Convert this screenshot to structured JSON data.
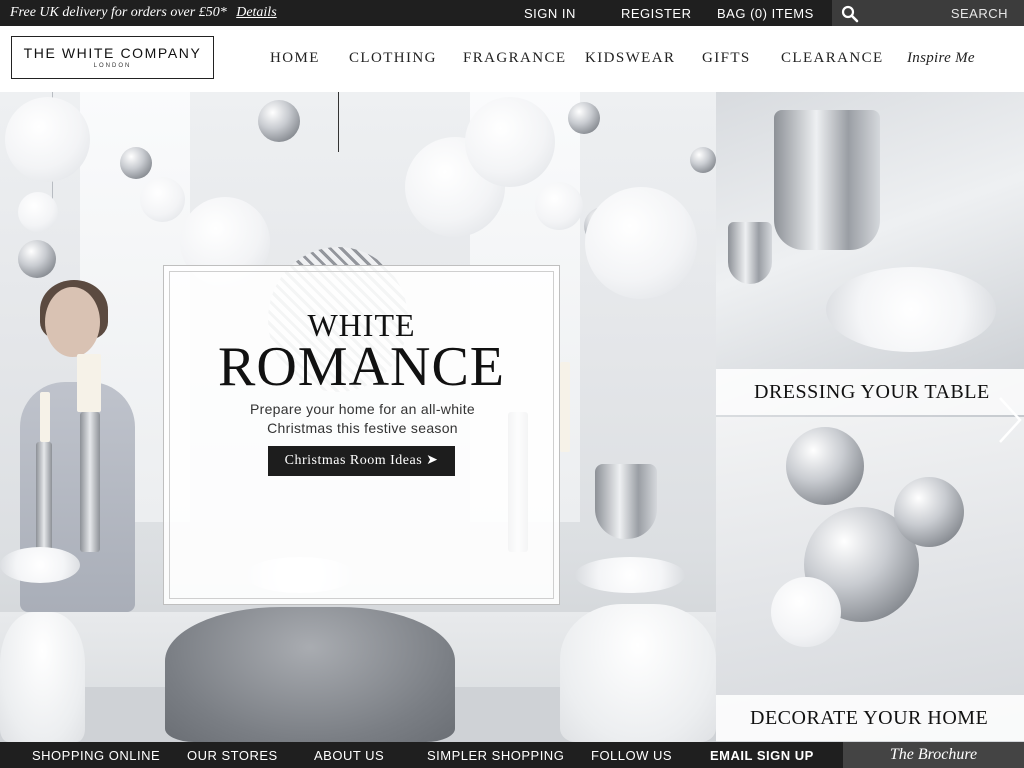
{
  "topbar": {
    "promo_text": "Free UK delivery for orders over £50*",
    "promo_link": "Details",
    "sign_in": "SIGN IN",
    "register": "REGISTER",
    "bag": "BAG (0) ITEMS",
    "search_placeholder": "SEARCH"
  },
  "brand": {
    "name": "THE WHITE COMPANY",
    "city": "LONDON"
  },
  "nav": {
    "items": [
      "HOME",
      "CLOTHING",
      "FRAGRANCE",
      "KIDSWEAR",
      "GIFTS",
      "CLEARANCE",
      "Inspire Me"
    ]
  },
  "hero": {
    "title_line1": "WHITE",
    "title_line2": "ROMANCE",
    "subtitle_line1": "Prepare your home for an all-white",
    "subtitle_line2": "Christmas this festive season",
    "cta": "Christmas Room Ideas ➤"
  },
  "panels": [
    {
      "label": "DRESSING YOUR TABLE"
    },
    {
      "label": "DECORATE YOUR HOME"
    }
  ],
  "footer": {
    "items": [
      "SHOPPING ONLINE",
      "OUR STORES",
      "ABOUT US",
      "SIMPLER SHOPPING",
      "FOLLOW US",
      "EMAIL SIGN UP"
    ],
    "brochure": "The Brochure"
  },
  "colors": {
    "bar_background": "#1f1f1f",
    "search_background": "#3c3c3c",
    "brochure_background": "#444444",
    "button_background": "#1d1d1d"
  },
  "icons": {
    "search": "search-icon",
    "next": "chevron-right-icon"
  }
}
